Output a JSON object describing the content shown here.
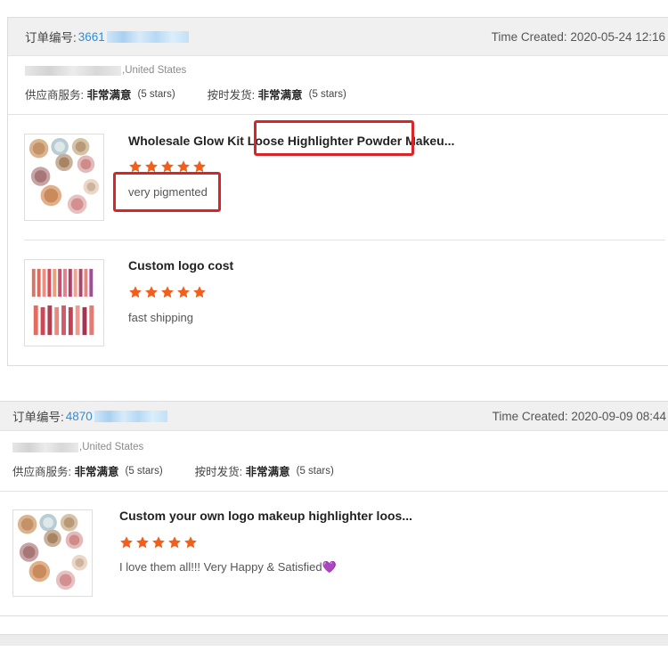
{
  "colors": {
    "accent_orange": "#f0601c",
    "link_blue": "#2d8fd6",
    "highlight_red": "#d9252a"
  },
  "labels": {
    "order_no": "订单编号:",
    "time_created": "Time Created:",
    "supplier_service": "供应商服务:",
    "on_time_shipping": "按时发货:"
  },
  "orders": [
    {
      "order_no_prefix": "3661",
      "time_created": "2020-05-24 12:16",
      "address_country": ",United States",
      "supplier_rating": "非常满意",
      "supplier_stars": "(5 stars)",
      "shipping_rating": "非常满意",
      "shipping_stars": "(5 stars)",
      "items": [
        {
          "name": "Wholesale Glow Kit Loose Highlighter Powder Makeu...",
          "rating": 5,
          "comment": "very pigmented",
          "thumb_icon": "highlighter-powder-image"
        },
        {
          "name": "Custom logo cost",
          "rating": 5,
          "comment": "fast shipping",
          "thumb_icon": "lip-gloss-image"
        }
      ]
    },
    {
      "order_no_prefix": "4870",
      "time_created": "2020-09-09 08:44",
      "address_country": ",United States",
      "supplier_rating": "非常满意",
      "supplier_stars": "(5 stars)",
      "shipping_rating": "非常满意",
      "shipping_stars": "(5 stars)",
      "items": [
        {
          "name": "Custom your own logo makeup highlighter loos...",
          "rating": 5,
          "comment": "I love them all!!! Very Happy & Satisfied",
          "comment_emoji": "💜",
          "thumb_icon": "highlighter-powder-image"
        }
      ]
    }
  ]
}
